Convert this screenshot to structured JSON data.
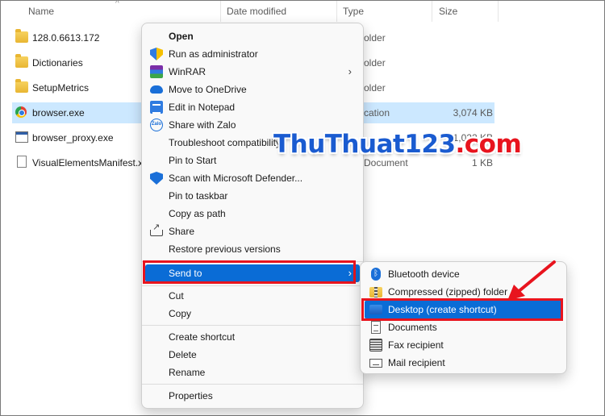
{
  "columns": {
    "name": "Name",
    "date": "Date modified",
    "type": "Type",
    "size": "Size"
  },
  "files": [
    {
      "name": "128.0.6613.172",
      "type": "older",
      "size": "",
      "icon": "folder-icon"
    },
    {
      "name": "Dictionaries",
      "type": "older",
      "size": "",
      "icon": "folder-icon"
    },
    {
      "name": "SetupMetrics",
      "type": "older",
      "size": "",
      "icon": "folder-icon"
    },
    {
      "name": "browser.exe",
      "type": "cation",
      "size": "3,074 KB",
      "icon": "browser-exe-icon",
      "selected": true
    },
    {
      "name": "browser_proxy.exe",
      "type": "",
      "size": "1,022 KB",
      "icon": "app-icon"
    },
    {
      "name": "VisualElementsManifest.x",
      "type": "Document",
      "size": "1 KB",
      "icon": "document-icon"
    }
  ],
  "context_menu": {
    "open": "Open",
    "run_admin": "Run as administrator",
    "winrar": "WinRAR",
    "move_onedrive": "Move to OneDrive",
    "edit_notepad": "Edit in Notepad",
    "share_zalo": "Share with Zalo",
    "troubleshoot": "Troubleshoot compatibility",
    "pin_start": "Pin to Start",
    "scan_defender": "Scan with Microsoft Defender...",
    "pin_taskbar": "Pin to taskbar",
    "copy_path": "Copy as path",
    "share": "Share",
    "restore_versions": "Restore previous versions",
    "send_to": "Send to",
    "cut": "Cut",
    "copy": "Copy",
    "create_shortcut": "Create shortcut",
    "delete": "Delete",
    "rename": "Rename",
    "properties": "Properties"
  },
  "send_to_menu": {
    "bluetooth": "Bluetooth device",
    "compressed": "Compressed (zipped) folder",
    "desktop": "Desktop (create shortcut)",
    "documents": "Documents",
    "fax": "Fax recipient",
    "mail": "Mail recipient"
  },
  "watermark": {
    "brand": "ThuThuat123",
    "suffix": ".com",
    "color": "#1a5bd0",
    "suffix_color": "#e8141e"
  },
  "colors": {
    "highlight": "#0a6cd6",
    "selection": "#cce8ff",
    "annotation_red": "#e8141e"
  }
}
